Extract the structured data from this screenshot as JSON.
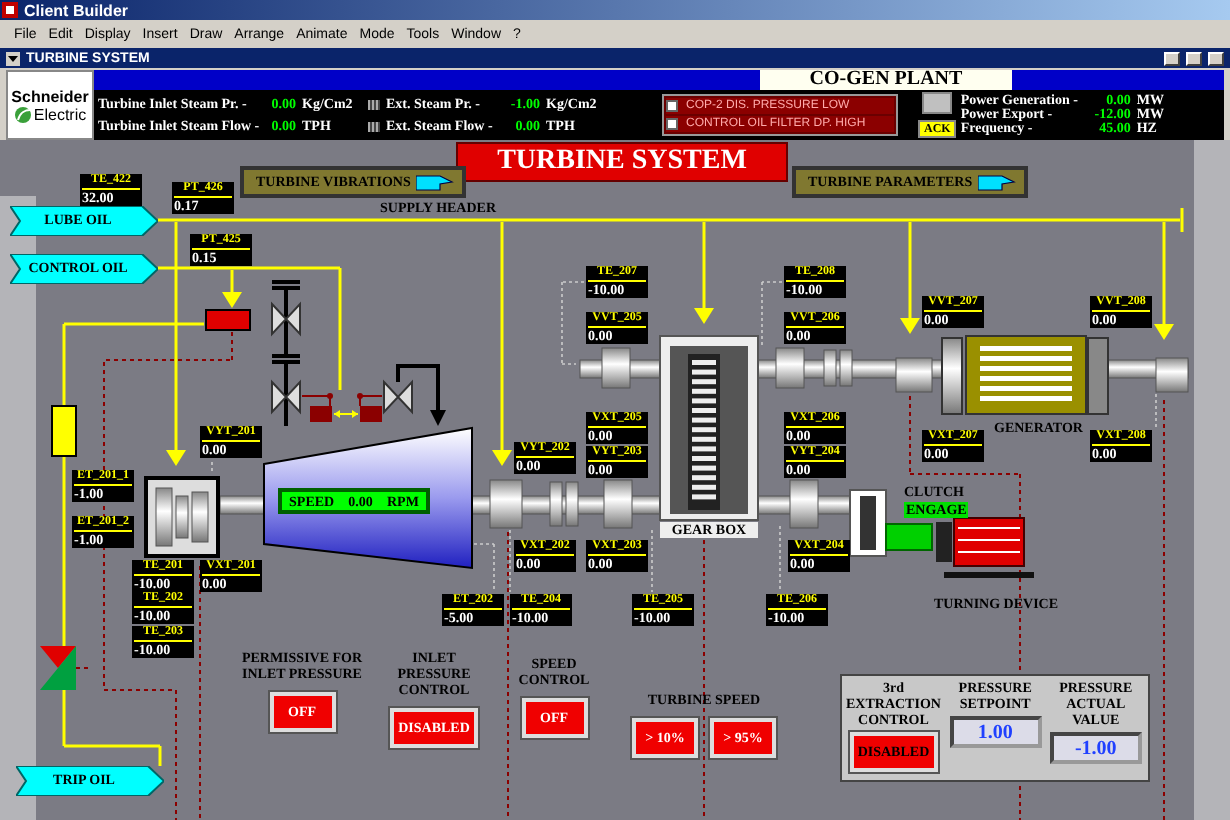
{
  "window": {
    "title": "Client Builder"
  },
  "menu": [
    "File",
    "Edit",
    "Display",
    "Insert",
    "Draw",
    "Arrange",
    "Animate",
    "Mode",
    "Tools",
    "Window",
    "?"
  ],
  "document": {
    "title": "TURBINE SYSTEM"
  },
  "header": {
    "logo": [
      "Schneider",
      "Electric"
    ],
    "banner": "CO-GEN PLANT",
    "readings": [
      {
        "label": "Turbine Inlet Steam Pr. -",
        "value": "0.00",
        "unit": "Kg/Cm2",
        "kind": "plain"
      },
      {
        "label": "Turbine Inlet Steam Flow -",
        "value": "0.00",
        "unit": "TPH",
        "kind": "plain"
      },
      {
        "label": "Ext. Steam Pr. -",
        "value": "-1.00",
        "unit": "Kg/Cm2",
        "kind": "extraction"
      },
      {
        "label": "Ext. Steam Flow -",
        "value": "0.00",
        "unit": "TPH",
        "kind": "extraction"
      }
    ],
    "alarms": [
      {
        "text": "COP-2 DIS. PRESSURE LOW",
        "checked": false
      },
      {
        "text": "CONTROL OIL FILTER DP. HIGH",
        "checked": false
      }
    ],
    "ack": "ACK",
    "power": [
      {
        "label": "Power Generation -",
        "value": "0.00",
        "unit": "MW"
      },
      {
        "label": "Power Export -",
        "value": "-12.00",
        "unit": "MW"
      },
      {
        "label": "Frequency -",
        "value": "45.00",
        "unit": "HZ"
      }
    ]
  },
  "diagram": {
    "title": "TURBINE SYSTEM",
    "nav_buttons": [
      "TURBINE VIBRATIONS",
      "TURBINE PARAMETERS"
    ],
    "oil_lines": [
      "LUBE OIL",
      "CONTROL OIL",
      "TRIP OIL"
    ],
    "labels": [
      "SUPPLY HEADER",
      "GEAR BOX",
      "GENERATOR",
      "CLUTCH",
      "TURNING DEVICE"
    ],
    "clutch_status": "ENGAGE",
    "speed": {
      "label": "SPEED",
      "value": "0.00",
      "unit": "RPM"
    },
    "tags": [
      {
        "label": "TE_422",
        "value": "32.00"
      },
      {
        "label": "PT_426",
        "value": "0.17"
      },
      {
        "label": "PT_425",
        "value": "0.15"
      },
      {
        "label": "ET_201_1",
        "value": "-1.00"
      },
      {
        "label": "ET_201_2",
        "value": "-1.00"
      },
      {
        "label": "VYT_201",
        "value": "0.00"
      },
      {
        "label": "TE_201",
        "value": "-10.00"
      },
      {
        "label": "TE_202",
        "value": "-10.00"
      },
      {
        "label": "TE_203",
        "value": "-10.00"
      },
      {
        "label": "VXT_201",
        "value": "0.00"
      },
      {
        "label": "VYT_202",
        "value": "0.00"
      },
      {
        "label": "VXT_202",
        "value": "0.00"
      },
      {
        "label": "ET_202",
        "value": "-5.00"
      },
      {
        "label": "TE_204",
        "value": "-10.00"
      },
      {
        "label": "TE_207",
        "value": "-10.00"
      },
      {
        "label": "VVT_205",
        "value": "0.00"
      },
      {
        "label": "VXT_205",
        "value": "0.00"
      },
      {
        "label": "VYT_203",
        "value": "0.00"
      },
      {
        "label": "VXT_203",
        "value": "0.00"
      },
      {
        "label": "TE_205",
        "value": "-10.00"
      },
      {
        "label": "TE_208",
        "value": "-10.00"
      },
      {
        "label": "VVT_206",
        "value": "0.00"
      },
      {
        "label": "VXT_206",
        "value": "0.00"
      },
      {
        "label": "VYT_204",
        "value": "0.00"
      },
      {
        "label": "VXT_204",
        "value": "0.00"
      },
      {
        "label": "TE_206",
        "value": "-10.00"
      },
      {
        "label": "VVT_207",
        "value": "0.00"
      },
      {
        "label": "VXT_207",
        "value": "0.00"
      },
      {
        "label": "VVT_208",
        "value": "0.00"
      },
      {
        "label": "VXT_208",
        "value": "0.00"
      }
    ],
    "controls": [
      {
        "label": "PERMISSIVE FOR INLET PRESSURE",
        "buttons": [
          "OFF"
        ]
      },
      {
        "label": "INLET PRESSURE CONTROL",
        "buttons": [
          "DISABLED"
        ]
      },
      {
        "label": "SPEED CONTROL",
        "buttons": [
          "OFF"
        ]
      },
      {
        "label": "TURBINE SPEED",
        "buttons": [
          "> 10%",
          "> 95%"
        ]
      }
    ],
    "extraction": [
      {
        "kind": "button",
        "label": "3rd EXTRACTION CONTROL",
        "value": "DISABLED"
      },
      {
        "kind": "display",
        "label": "PRESSURE SETPOINT",
        "value": "1.00"
      },
      {
        "kind": "display",
        "label": "PRESSURE ACTUAL VALUE",
        "value": "-1.00"
      }
    ]
  }
}
